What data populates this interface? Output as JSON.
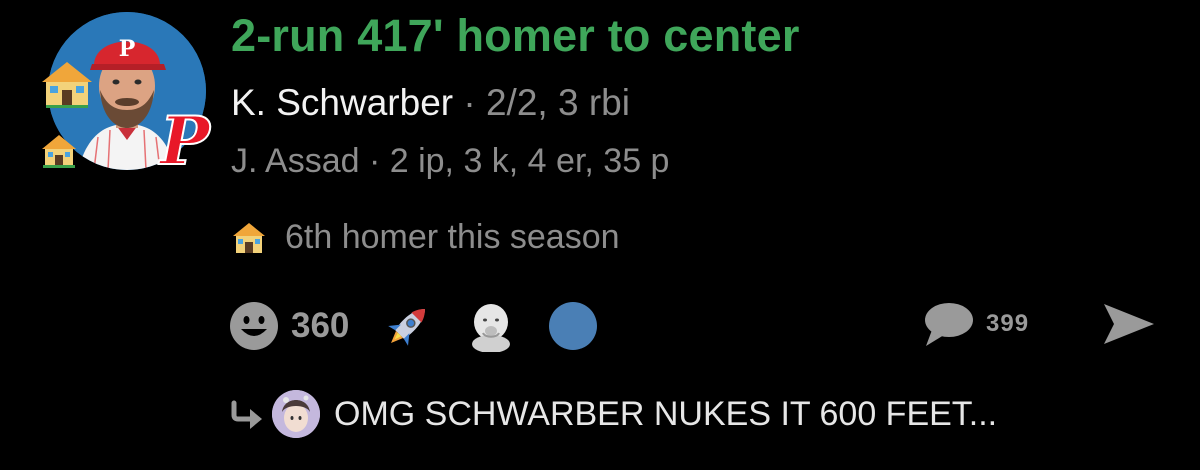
{
  "post": {
    "headline": "2-run 417' homer to center",
    "batter": {
      "name": "K. Schwarber",
      "separator": " · ",
      "stats": "2/2, 3 rbi"
    },
    "pitcher": {
      "text": "J. Assad · 2 ip, 3 k, 4 er, 35 p"
    },
    "season_note": "6th homer this season",
    "avatar": {
      "logo_letter": "P",
      "cap_letter": "P"
    }
  },
  "reactions": {
    "count": "360",
    "items": [
      "smiley-icon",
      "rocket-icon",
      "baby-face-icon",
      "blue-circle-icon"
    ]
  },
  "comments": {
    "count": "399"
  },
  "reply": {
    "text": "OMG SCHWARBER NUKES IT 600 FEET..."
  },
  "colors": {
    "background": "#000000",
    "headline_green": "#3fa65a",
    "muted_gray": "#8d8d8d",
    "phillies_red": "#e81828",
    "dot_blue": "#4a7fb5"
  }
}
